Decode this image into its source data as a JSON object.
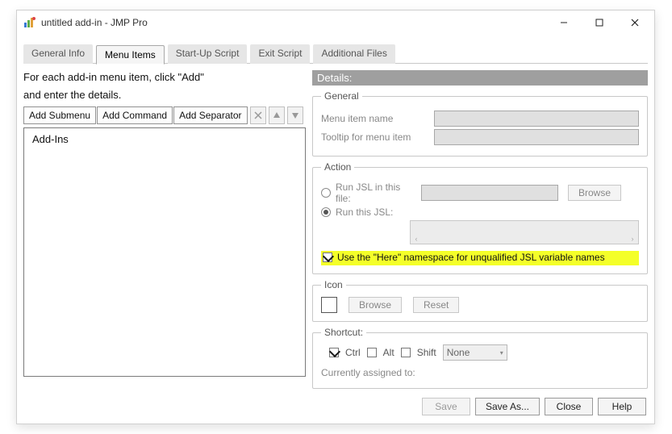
{
  "window": {
    "title": "untitled add-in - JMP Pro"
  },
  "tabs": {
    "general_info": "General Info",
    "menu_items": "Menu Items",
    "startup": "Start-Up Script",
    "exit": "Exit Script",
    "additional": "Additional Files"
  },
  "left": {
    "intro_line1": "For each add-in menu item, click \"Add\"",
    "intro_line2": "and enter the details.",
    "add_submenu": "Add Submenu",
    "add_command": "Add Command",
    "add_separator": "Add Separator",
    "tree_root": "Add-Ins"
  },
  "details": {
    "header": "Details:",
    "general_legend": "General",
    "menu_item_name": "Menu item name",
    "tooltip_label": "Tooltip for menu item",
    "action_legend": "Action",
    "run_file": "Run JSL in this file:",
    "run_jsl": "Run this JSL:",
    "browse": "Browse",
    "here_ns": "Use the \"Here\" namespace for unqualified JSL variable names",
    "icon_legend": "Icon",
    "reset": "Reset",
    "shortcut_legend": "Shortcut:",
    "ctrl": "Ctrl",
    "alt": "Alt",
    "shift": "Shift",
    "none": "None",
    "currently": "Currently assigned to:"
  },
  "footer": {
    "save": "Save",
    "save_as": "Save As...",
    "close": "Close",
    "help": "Help"
  }
}
